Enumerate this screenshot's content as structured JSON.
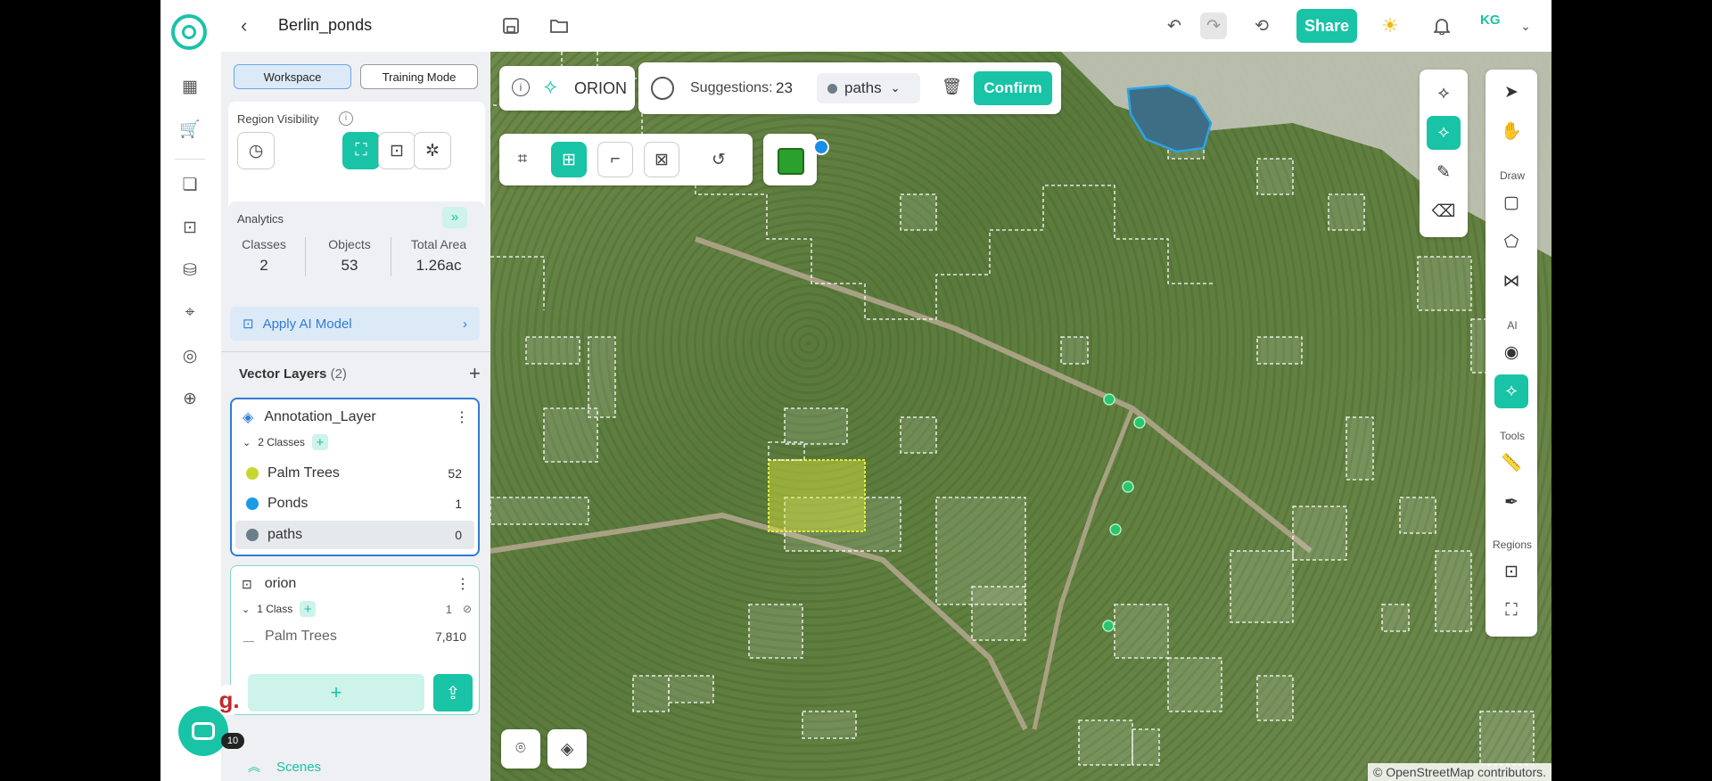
{
  "project": {
    "title": "Berlin_ponds"
  },
  "topbar": {
    "share_label": "Share",
    "avatar_initials": "KG"
  },
  "panel": {
    "modes": [
      "Workspace",
      "Training Mode"
    ],
    "region_visibility_label": "Region Visibility",
    "analytics": {
      "title": "Analytics",
      "stats": [
        {
          "label": "Classes",
          "value": "2"
        },
        {
          "label": "Objects",
          "value": "53"
        },
        {
          "label": "Total Area",
          "value": "1.26ac"
        }
      ]
    },
    "apply_ai_label": "Apply AI Model",
    "vector_layers": {
      "title": "Vector Layers",
      "count": "(2)"
    },
    "layers": [
      {
        "name": "Annotation_Layer",
        "classes_label": "2 Classes",
        "classes": [
          {
            "name": "Palm Trees",
            "count": "52",
            "color": "#c8d630"
          },
          {
            "name": "Ponds",
            "count": "1",
            "color": "#1a9be6"
          },
          {
            "name": "paths",
            "count": "0",
            "color": "#6b7e8a"
          }
        ]
      },
      {
        "name": "orion",
        "classes_label": "1 Class",
        "hidden_count": "1",
        "classes": [
          {
            "name": "Palm Trees",
            "count": "7,810"
          }
        ]
      }
    ],
    "badge_count": "10",
    "scenes_label": "Scenes"
  },
  "map_toolbar": {
    "orion_label": "ORION",
    "suggestions_label": "Suggestions:",
    "suggestions_count": "23",
    "class_select": "paths",
    "confirm_label": "Confirm"
  },
  "right_toolbar": {
    "sections": [
      "Draw",
      "AI",
      "Tools",
      "Regions"
    ]
  },
  "attribution": "© OpenStreetMap contributors.",
  "colors": {
    "accent": "#19c3a6",
    "selection_blue": "#2f7cd6"
  }
}
